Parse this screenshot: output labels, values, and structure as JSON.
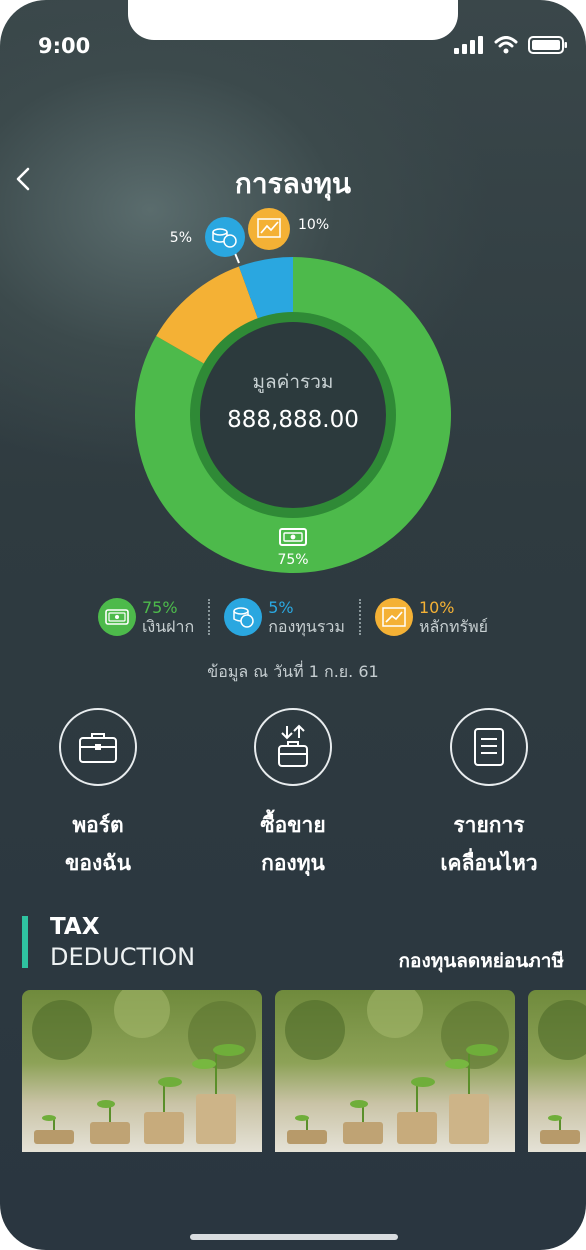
{
  "status_bar": {
    "time": "9:00"
  },
  "header": {
    "title": "การลงทุน"
  },
  "summary": {
    "label": "มูลค่ารวม",
    "total": "888,888.00"
  },
  "chart_data": {
    "type": "pie",
    "categories": [
      "เงินฝาก",
      "กองทุนรวม",
      "หลักทรัพย์"
    ],
    "values": [
      75,
      5,
      10
    ],
    "colors": [
      "#4dba4b",
      "#2aa7e0",
      "#f4b135"
    ],
    "slice_labels": [
      "75%",
      "5%",
      "10%"
    ]
  },
  "legend": [
    {
      "pct": "75%",
      "label": "เงินฝาก",
      "color": "#4dba4b",
      "icon": "banknote-icon"
    },
    {
      "pct": "5%",
      "label": "กองทุนรวม",
      "color": "#2aa7e0",
      "icon": "coins-icon"
    },
    {
      "pct": "10%",
      "label": "หลักทรัพย์",
      "color": "#f4b135",
      "icon": "trend-chart-icon"
    }
  ],
  "as_of": "ข้อมูล ณ วันที่ 1 ก.ย. 61",
  "actions": [
    {
      "line1": "พอร์ต",
      "line2": "ของฉัน",
      "icon": "briefcase-icon"
    },
    {
      "line1": "ซื้อขาย",
      "line2": "กองทุน",
      "icon": "buy-sell-icon"
    },
    {
      "line1": "รายการ",
      "line2": "เคลื่อนไหว",
      "icon": "document-list-icon"
    }
  ],
  "tax": {
    "line1": "TAX",
    "line2": "DEDUCTION",
    "link": "กองทุนลดหย่อนภาษี"
  },
  "cards": [
    {
      "image": "coins-plants-photo"
    },
    {
      "image": "coins-plants-photo"
    },
    {
      "image": "coins-plants-photo"
    }
  ]
}
